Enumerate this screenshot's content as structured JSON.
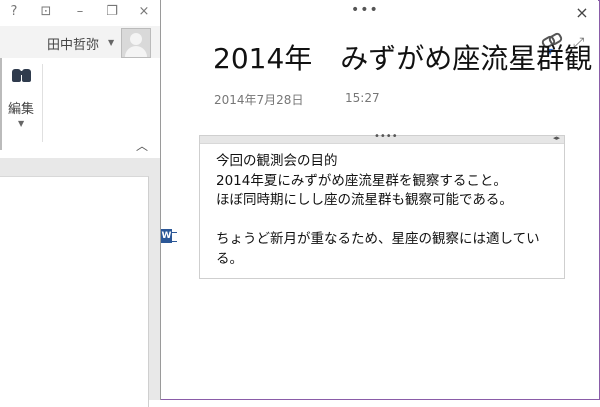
{
  "word_window": {
    "help_label": "?",
    "ribbon_options_label": "⊡",
    "minimize_label": "–",
    "restore_label": "❐",
    "close_label": "×",
    "user_name": "田中哲弥",
    "user_caret": "▼",
    "edit_group_label": "編集",
    "edit_caret": "▼",
    "collapse_caret": "︿"
  },
  "note": {
    "drag_handle": "•••",
    "close_label": "×",
    "expand_label": "⤢",
    "title": "2014年　みずがめ座流星群観",
    "date": "2014年7月28日",
    "time": "15:27",
    "linked_app_letter": "W",
    "outline_handle": "••••",
    "outline_arrows": "◂▸",
    "lines": [
      "今回の観測会の目的",
      "2014年夏にみずがめ座流星群を観察すること。",
      "ほぼ同時期にしし座の流星群も観察可能である。",
      "",
      "ちょうど新月が重なるため、星座の観察には適してい",
      "る。"
    ]
  },
  "colors": {
    "frame": "#8a5ca8",
    "word_blue": "#2b5797",
    "link_accent": "#2b6fd6"
  }
}
